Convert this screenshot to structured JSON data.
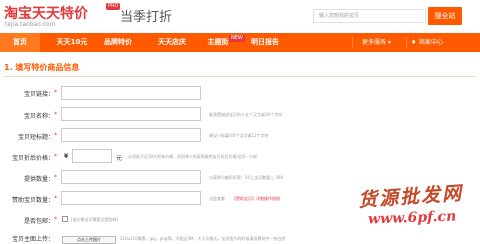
{
  "header": {
    "logo": "淘宝天天特价",
    "logo_badge": "PRO",
    "logo_url": "tejia.taobao.com",
    "slogan": "当季打折",
    "search_placeholder": "输入您想找的宝贝",
    "search_button": "搜全站"
  },
  "nav": {
    "items": [
      {
        "label": "首页",
        "active": true
      },
      {
        "label": "天天10元",
        "active": false
      },
      {
        "label": "品牌特价",
        "active": false
      },
      {
        "label": "天天店庆",
        "active": false
      },
      {
        "label": "主题街",
        "active": false,
        "badge": "NEW"
      },
      {
        "label": "明日报告",
        "active": false
      }
    ],
    "more": "更多服务 ▾",
    "seller": "商家中心"
  },
  "form": {
    "section_title": "1. 填写特价商品信息",
    "rows": [
      {
        "label": "宝贝链接：",
        "hint": ""
      },
      {
        "label": "宝贝名称：",
        "hint": "能清楚描述宝贝的十五个汉字或30个字符"
      },
      {
        "label": "宝贝短标题：",
        "hint": "建议小标填写6个汉字或12个字符"
      },
      {
        "label": "宝贝折后价格：",
        "currency": "¥",
        "unit": "元",
        "hint": "必须低于近30天所有价格，折扣率<也高等级的宝贝折后价格/宝贝一口价"
      },
      {
        "label": "提供数量：",
        "hint": "以获得小额折扣率：50上宝贝数量上 300"
      },
      {
        "label": "赞助宝贝数量：",
        "hint": "点此查看",
        "link": "【赞助宝贝】详细操作指南"
      },
      {
        "label": "是否包邮：",
        "checkbox_label": "(该价格宝贝需要全国包邮)"
      }
    ]
  },
  "bottom": {
    "label": "宝贝主图上传：",
    "button": "点击上传图片",
    "hint": "310x310像素，jpg，png等，不超过3M，大小及格式，宝贝图片的时候请选择其中一张白底"
  },
  "watermark": {
    "line1": "货源批发网",
    "line2": "www.6pf.cn"
  }
}
